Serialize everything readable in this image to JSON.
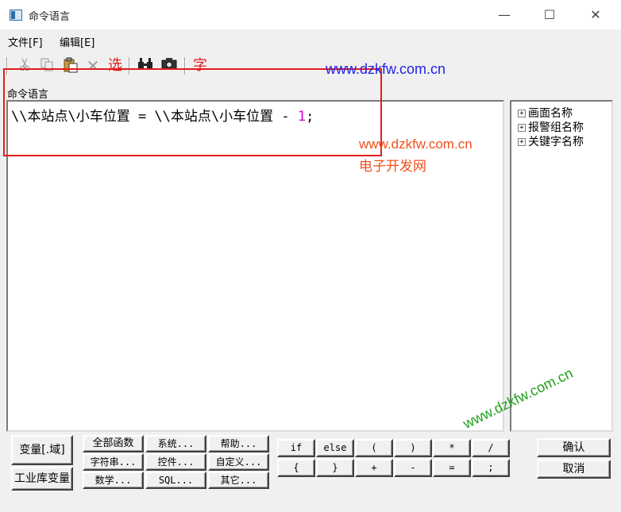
{
  "window": {
    "title": "命令语言",
    "minimize": "—",
    "maximize": "☐",
    "close": "✕"
  },
  "menu": [
    {
      "label": "文件[F]"
    },
    {
      "label": "编辑[E]"
    }
  ],
  "toolbar": {
    "select_label": "选",
    "char_label": "字",
    "icons": [
      "cut-icon",
      "copy-icon",
      "paste-icon",
      "delete-icon",
      "select-icon",
      "find-icon",
      "camera-icon",
      "char-icon"
    ]
  },
  "section_label": "命令语言",
  "editor": {
    "code_prefix": "\\\\本站点\\小车位置 = \\\\本站点\\小车位置 - ",
    "code_number": "1",
    "code_suffix": ";"
  },
  "tree": {
    "items": [
      {
        "label": "画面名称",
        "expander": "+"
      },
      {
        "label": "报警组名称",
        "expander": "+"
      },
      {
        "label": "关键字名称",
        "expander": "+"
      }
    ]
  },
  "watermarks": {
    "blue": "www.dzkfw.com.cn",
    "orange_url": "www.dzkfw.com.cn",
    "orange_text": "电子开发网",
    "green": "www.dzkfw.com.cn"
  },
  "buttons": {
    "variable_domain": "变量[.域]",
    "library_variable": "工业库变量",
    "functions": [
      "全部函数",
      "系统...",
      "帮助...",
      "字符串...",
      "控件...",
      "自定义...",
      "数学...",
      "SQL...",
      "其它..."
    ],
    "operators": [
      "if",
      "else",
      "(",
      ")",
      "*",
      "/",
      "{",
      "}",
      "+",
      "-",
      "=",
      ";"
    ],
    "confirm": "确认",
    "cancel": "取消"
  },
  "colors": {
    "annotation_box": "#e51c1c",
    "number_literal": "#d000d0",
    "watermark_blue": "#2323e6",
    "watermark_orange": "#f0501e",
    "watermark_green": "#1ea01e"
  }
}
